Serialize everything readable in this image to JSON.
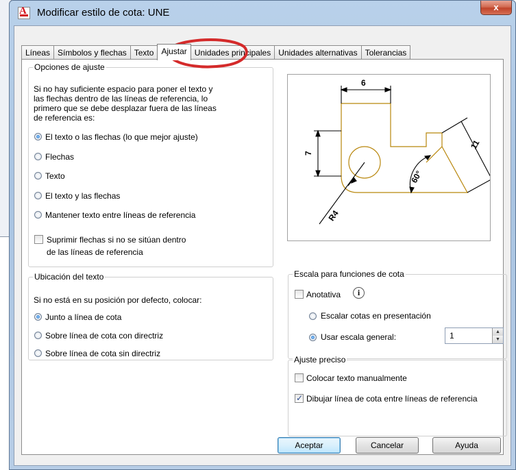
{
  "window": {
    "title": "Modificar estilo de cota: UNE",
    "close_glyph": "x"
  },
  "tabs": [
    {
      "label": "Líneas",
      "active": false
    },
    {
      "label": "Símbolos y flechas",
      "active": false
    },
    {
      "label": "Texto",
      "active": false
    },
    {
      "label": "Ajustar",
      "active": true
    },
    {
      "label": "Unidades principales",
      "active": false
    },
    {
      "label": "Unidades alternativas",
      "active": false
    },
    {
      "label": "Tolerancias",
      "active": false
    }
  ],
  "fit_options": {
    "title": "Opciones de ajuste",
    "description": [
      "Si no hay suficiente espacio para poner el texto y",
      "las flechas dentro de las líneas de referencia, lo",
      "primero que se debe desplazar fuera de las líneas",
      "de referencia es:"
    ],
    "options": [
      {
        "label": "El texto o las flechas (lo que mejor ajuste)",
        "selected": true
      },
      {
        "label": "Flechas",
        "selected": false
      },
      {
        "label": "Texto",
        "selected": false
      },
      {
        "label": "El texto y las flechas",
        "selected": false
      },
      {
        "label": "Mantener texto entre líneas de referencia",
        "selected": false
      }
    ],
    "suppress_label_1": "Suprimir flechas si no se sitúan dentro",
    "suppress_label_2": "de las líneas de referencia",
    "suppress_checked": false
  },
  "text_placement": {
    "title": "Ubicación del texto",
    "prompt": "Si no está en su posición por defecto, colocar:",
    "options": [
      {
        "label": "Junto a línea de cota",
        "selected": true
      },
      {
        "label": "Sobre línea de cota con directriz",
        "selected": false
      },
      {
        "label": "Sobre línea de cota sin directriz",
        "selected": false
      }
    ]
  },
  "preview": {
    "dim_top": "6",
    "dim_left": "7",
    "dim_slant": "11",
    "dim_angle": "60°",
    "dim_radius": "R4",
    "line_color": "#b8860b"
  },
  "scale": {
    "title": "Escala para funciones de cota",
    "annotative_label": "Anotativa",
    "annotative_checked": false,
    "info_glyph": "i",
    "scale_layout_label": "Escalar cotas en presentación",
    "scale_layout_selected": false,
    "overall_label": "Usar escala general:",
    "overall_selected": true,
    "overall_value": "1"
  },
  "fine_tuning": {
    "title": "Ajuste preciso",
    "manual_label": "Colocar texto manualmente",
    "manual_checked": false,
    "draw_line_label": "Dibujar línea de cota entre líneas de referencia",
    "draw_line_checked": true
  },
  "buttons": {
    "ok": "Aceptar",
    "cancel": "Cancelar",
    "help": "Ayuda"
  },
  "annotation": {
    "color": "#d42a2a"
  }
}
